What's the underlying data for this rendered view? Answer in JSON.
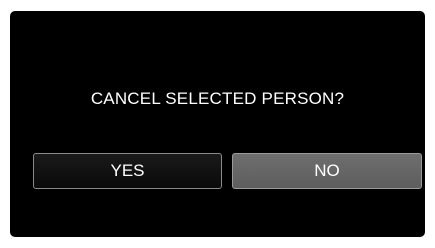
{
  "dialog": {
    "prompt": "CANCEL SELECTED PERSON?",
    "buttons": {
      "yes_label": "YES",
      "no_label": "NO"
    },
    "selected_button": "YES"
  },
  "colors": {
    "screen_background": "#000000",
    "text": "#ffffff",
    "selected_button_background": "#111111",
    "unselected_button_background": "#656565",
    "button_border": "#8a8a8a"
  }
}
